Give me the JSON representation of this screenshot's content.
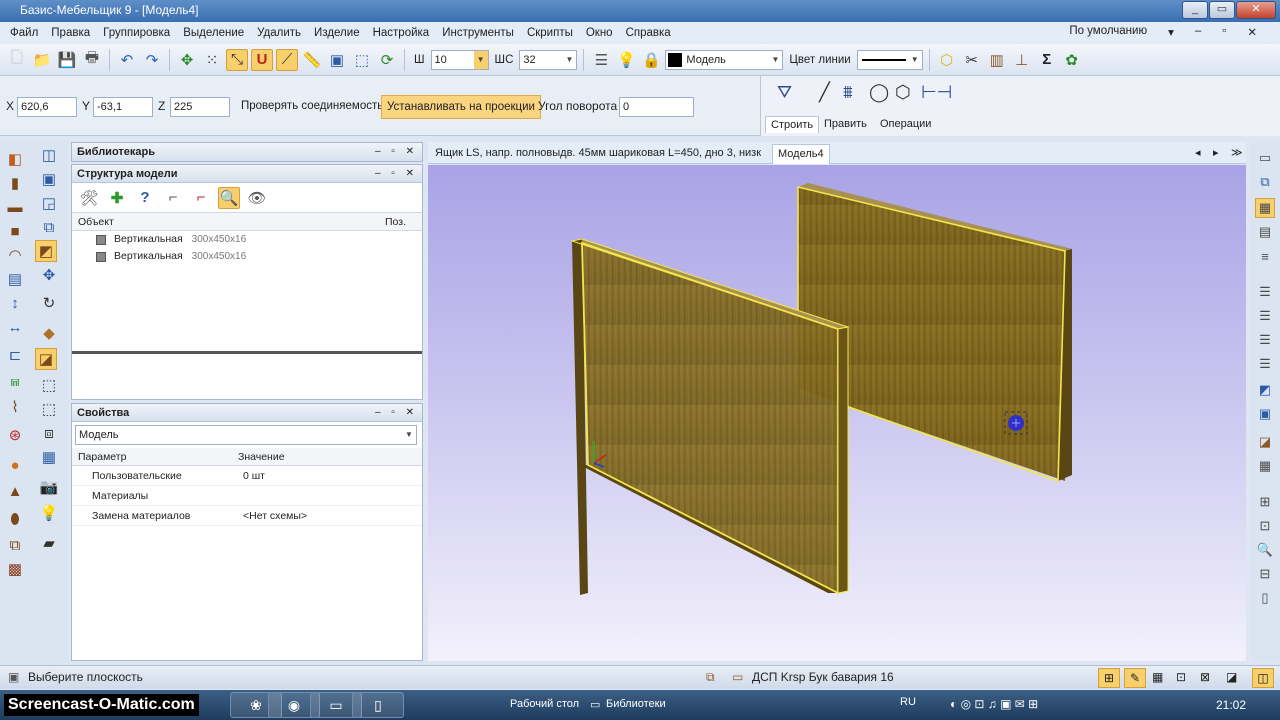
{
  "window": {
    "title": "Базис-Мебельщик 9 - [Модель4]",
    "controls": [
      "_",
      "▭",
      "✕"
    ]
  },
  "menu": {
    "items": [
      "Файл",
      "Правка",
      "Группировка",
      "Выделение",
      "Удалить",
      "Изделие",
      "Настройка",
      "Инструменты",
      "Скрипты",
      "Окно",
      "Справка"
    ],
    "layout_preset": "По умолчанию",
    "layout_controls": [
      "–",
      "▫",
      "✕"
    ]
  },
  "toolbar": {
    "w_label": "Ш",
    "w_value": "10",
    "ws_label": "ШС",
    "ws_value": "32",
    "layer_value": "Модель",
    "line_color_label": "Цвет линии",
    "sigma": "Σ"
  },
  "coords": {
    "x_label": "X",
    "x_value": "620,6",
    "y_label": "Y",
    "y_value": "-63,1",
    "z_label": "Z",
    "z_value": "225",
    "check_connect": "Проверять соединяемость",
    "set_projection": "Устанавливать на проекции",
    "angle_label": "Угол поворота",
    "angle_value": "0"
  },
  "ribbon": {
    "tabs": [
      "Строить",
      "Править",
      "Операции"
    ]
  },
  "librarian": {
    "title": "Библиотекарь",
    "controls": "– ▫ ✕"
  },
  "structure": {
    "title": "Структура модели",
    "controls": "– ▫ ✕",
    "col_object": "Объект",
    "col_pos": "Поз.",
    "rows": [
      {
        "name": "Вертикальная",
        "dims": "300x450x16"
      },
      {
        "name": "Вертикальная",
        "dims": "300x450x16"
      }
    ]
  },
  "properties": {
    "title": "Свойства",
    "controls": "– ▫ ✕",
    "selector": "Модель",
    "col_param": "Параметр",
    "col_value": "Значение",
    "rows": [
      {
        "key": "Пользовательские",
        "value": "0 шт"
      },
      {
        "key": "Материалы",
        "value": ""
      },
      {
        "key": "Замена материалов",
        "value": "<Нет схемы>"
      }
    ]
  },
  "doc_tabs": {
    "tabs": [
      "Ящик LS, напр. полновыдв. 45мм шариковая L=450, дно 3, низк",
      "Модель4"
    ],
    "nav": [
      "◂",
      "▸",
      "≫"
    ]
  },
  "status": {
    "hint": "Выберите плоскость",
    "material": "ДСП Krsp Бук бавария 16"
  },
  "taskbar": {
    "watermark": "Screencast-O-Matic.com",
    "desktop": "Рабочий стол",
    "libraries": "Библиотеки",
    "lang": "RU",
    "time": "21:02"
  },
  "colors": {
    "accent": "#f7cf6b",
    "panel_face": "#8b7024",
    "outline": "#f2e64a",
    "viewport_top": "#a9a3e6"
  }
}
